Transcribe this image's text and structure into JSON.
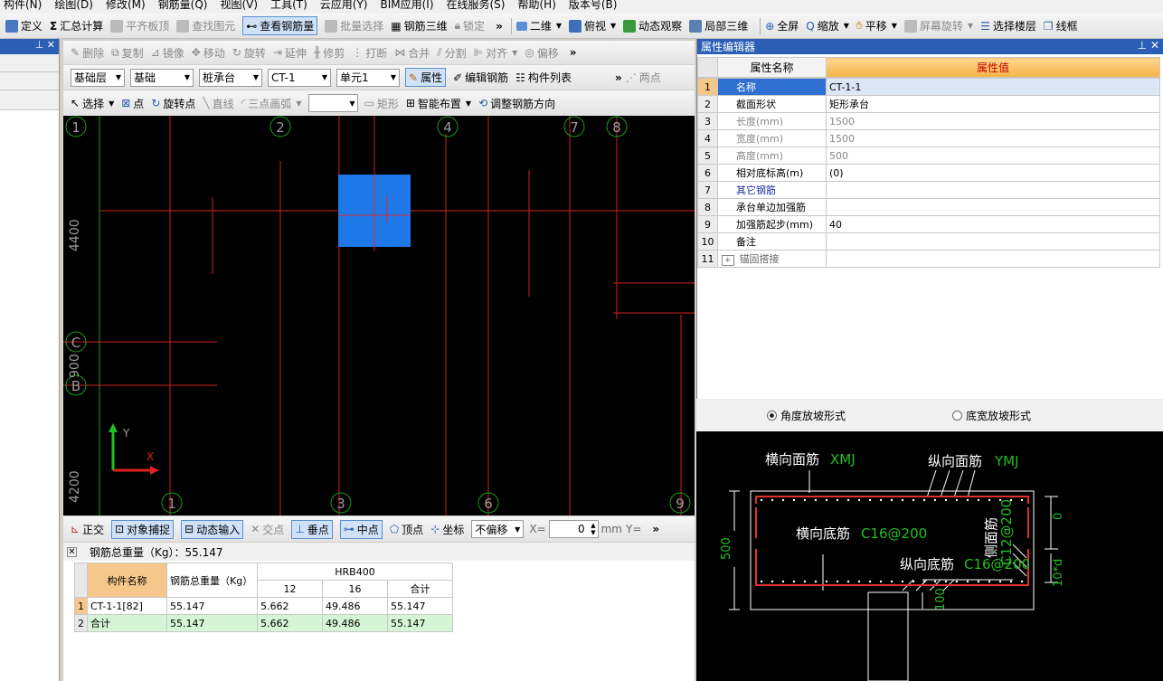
{
  "menu": [
    "构件(N)",
    "绘图(D)",
    "修改(M)",
    "钢筋量(Q)",
    "视图(V)",
    "工具(T)",
    "云应用(Y)",
    "BIM应用(I)",
    "在线服务(S)",
    "帮助(H)",
    "版本号(B)"
  ],
  "toolbar1": {
    "items": [
      {
        "label": "定义",
        "dis": false
      },
      {
        "label": "汇总计算",
        "dis": false
      },
      {
        "label": "平齐板顶",
        "dis": true
      },
      {
        "label": "查找图元",
        "dis": true
      },
      {
        "label": "查看钢筋量",
        "dis": false,
        "active": true
      },
      {
        "label": "批量选择",
        "dis": true
      },
      {
        "label": "钢筋三维",
        "dis": false
      },
      {
        "label": "锁定",
        "dis": true
      }
    ],
    "right": [
      {
        "label": "二维"
      },
      {
        "label": "俯视"
      },
      {
        "label": "动态观察"
      },
      {
        "label": "局部三维"
      },
      {
        "label": "全屏"
      },
      {
        "label": "缩放"
      },
      {
        "label": "平移"
      },
      {
        "label": "屏幕旋转",
        "dis": true
      },
      {
        "label": "选择楼层"
      },
      {
        "label": "线框"
      }
    ]
  },
  "toolbar2": [
    "删除",
    "复制",
    "镜像",
    "移动",
    "旋转",
    "延伸",
    "修剪",
    "打断",
    "合并",
    "分割",
    "对齐",
    "偏移"
  ],
  "toolbar3": {
    "combos": [
      "基础层",
      "基础",
      "桩承台",
      "CT-1",
      "单元1"
    ],
    "property": "属性",
    "edit_rebar": "编辑钢筋",
    "component_list": "构件列表",
    "two_points": "两点"
  },
  "toolbar4": {
    "select": "选择",
    "point": "点",
    "rotate_point": "旋转点",
    "line": "直线",
    "arc": "三点画弧",
    "rect": "矩形",
    "smart": "智能布置",
    "adjust": "调整钢筋方向"
  },
  "canvas": {
    "axis_top": [
      "1",
      "2",
      "4",
      "7",
      "8"
    ],
    "axis_bottom": [
      "1",
      "3",
      "6",
      "9"
    ],
    "axis_left": [
      "C",
      "B"
    ],
    "dims_left": [
      "4400",
      "900",
      "4200"
    ],
    "axis_x": "X",
    "axis_y": "Y"
  },
  "snapbar": {
    "ortho": "正交",
    "snap": "对象捕捉",
    "dynamic": "动态输入",
    "intersect": "交点",
    "perp": "垂点",
    "mid": "中点",
    "vertex": "顶点",
    "coord": "坐标",
    "offset": "不偏移",
    "x_label": "X=",
    "x_value": "0",
    "unit": "mm",
    "y_label": "Y="
  },
  "summary": {
    "title": "钢筋总重量（Kg）：55.147",
    "headers": {
      "name": "构件名称",
      "total": "钢筋总重量（Kg）",
      "grade": "HRB400",
      "d12": "12",
      "d16": "16",
      "sum": "合计"
    },
    "rows": [
      {
        "no": "1",
        "name": "CT-1-1[82]",
        "total": "55.147",
        "d12": "5.662",
        "d16": "49.486",
        "sum": "55.147"
      },
      {
        "no": "2",
        "name": "合计",
        "total": "55.147",
        "d12": "5.662",
        "d16": "49.486",
        "sum": "55.147"
      }
    ]
  },
  "props": {
    "title": "属性编辑器",
    "col_name": "属性名称",
    "col_value": "属性值",
    "rows": [
      {
        "no": "1",
        "name": "名称",
        "value": "CT-1-1"
      },
      {
        "no": "2",
        "name": "截面形状",
        "value": "矩形承台"
      },
      {
        "no": "3",
        "name": "长度(mm)",
        "value": "1500"
      },
      {
        "no": "4",
        "name": "宽度(mm)",
        "value": "1500"
      },
      {
        "no": "5",
        "name": "高度(mm)",
        "value": "500"
      },
      {
        "no": "6",
        "name": "相对底标高(m)",
        "value": "(0)"
      },
      {
        "no": "7",
        "name": "其它钢筋",
        "value": ""
      },
      {
        "no": "8",
        "name": "承台单边加强筋",
        "value": ""
      },
      {
        "no": "9",
        "name": "加强筋起步(mm)",
        "value": "40"
      },
      {
        "no": "10",
        "name": "备注",
        "value": ""
      },
      {
        "no": "11",
        "name": "锚固搭接",
        "value": ""
      }
    ]
  },
  "slope": {
    "opt1": "角度放坡形式",
    "opt2": "底宽放坡形式"
  },
  "diagram": {
    "top_h": "横向面筋",
    "top_h_code": "XMJ",
    "top_v": "纵向面筋",
    "top_v_code": "YMJ",
    "bot_h": "横向底筋",
    "bot_h_val": "C16@200",
    "bot_v": "纵向底筋",
    "bot_v_val": "C16@200",
    "side": "侧面筋",
    "side_val": "C12@200",
    "height": "500",
    "zero": "0",
    "ten_d": "10*d",
    "hundred": "100"
  }
}
